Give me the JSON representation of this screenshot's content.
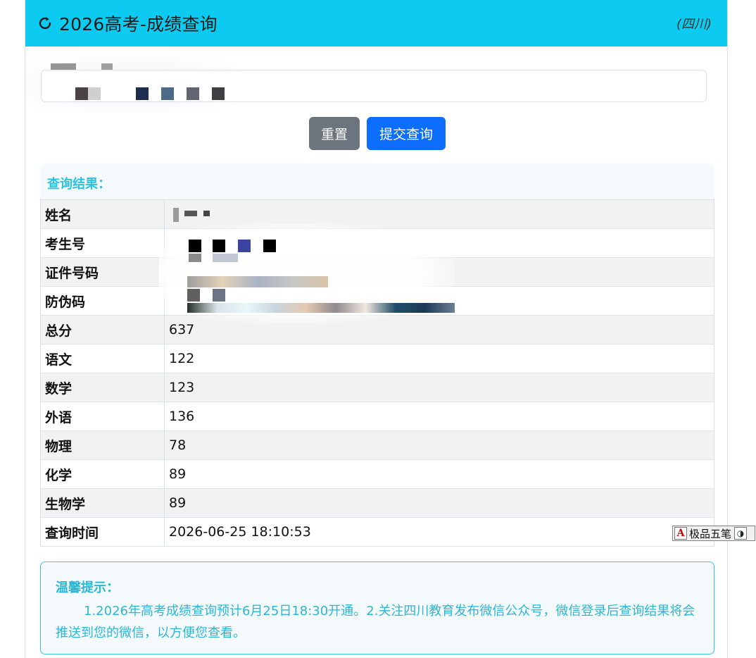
{
  "header": {
    "title": "2026高考-成绩查询",
    "province": "(四川)",
    "refresh_icon": "refresh-icon"
  },
  "buttons": {
    "reset": "重置",
    "submit": "提交查询"
  },
  "result": {
    "heading": "查询结果：",
    "rows": [
      {
        "label": "姓名",
        "value": ""
      },
      {
        "label": "考生号",
        "value": ""
      },
      {
        "label": "证件号码",
        "value": ""
      },
      {
        "label": "防伪码",
        "value": ""
      },
      {
        "label": "总分",
        "value": "637"
      },
      {
        "label": "语文",
        "value": "122"
      },
      {
        "label": "数学",
        "value": "123"
      },
      {
        "label": "外语",
        "value": "136"
      },
      {
        "label": "物理",
        "value": "78"
      },
      {
        "label": "化学",
        "value": "89"
      },
      {
        "label": "生物学",
        "value": "89"
      },
      {
        "label": "查询时间",
        "value": "2026-06-25 18:10:53"
      }
    ]
  },
  "tips": {
    "title": "温馨提示：",
    "body": "1.2026年高考成绩查询预计6月25日18:30开通。2.关注四川教育发布微信公众号，微信登录后查询结果将会推送到您的微信，以方便您查看。"
  },
  "ime": {
    "label": "极品五笔",
    "a_glyph": "A",
    "moon_glyph": "◑"
  },
  "colors": {
    "header_bg": "#0dcaf0",
    "reset_btn": "#6c757d",
    "submit_btn": "#0d6efd",
    "accent_text": "#2cc2e2",
    "row_stripe": "#f2f2f2"
  }
}
